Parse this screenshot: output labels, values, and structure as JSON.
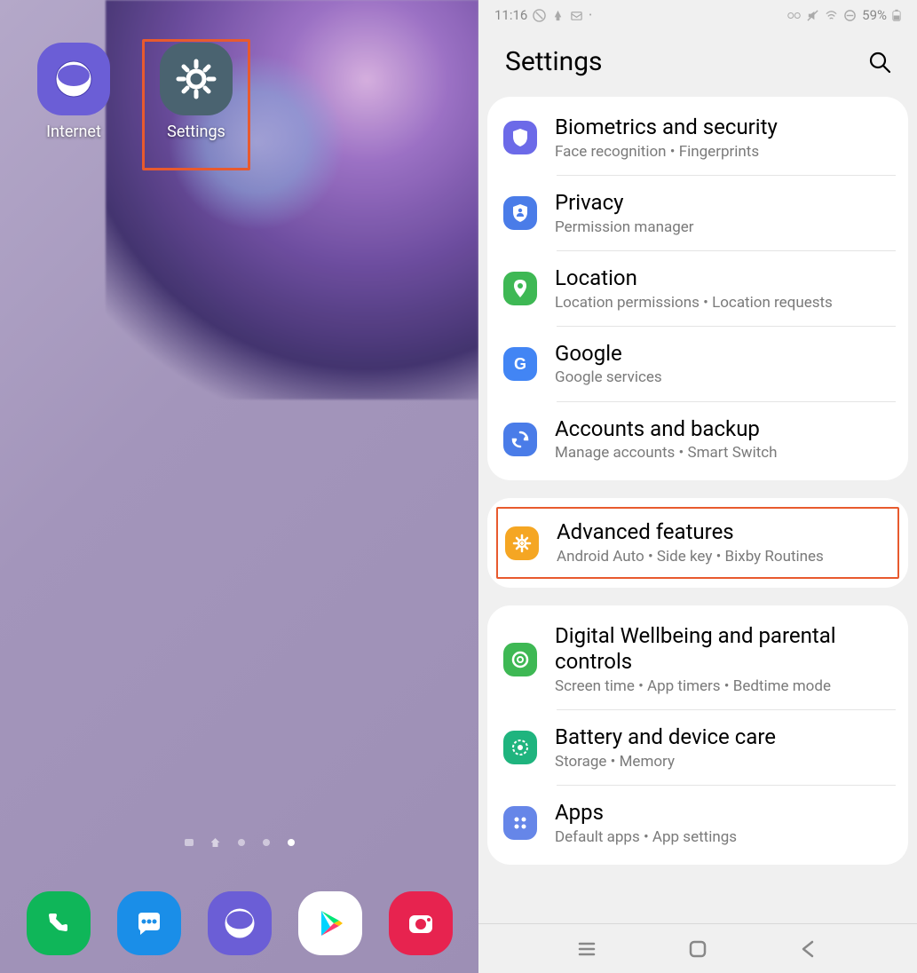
{
  "home": {
    "apps": {
      "internet": {
        "label": "Internet"
      },
      "settings": {
        "label": "Settings"
      }
    },
    "dock_icons": [
      "phone",
      "messages",
      "internet",
      "play-store",
      "camera"
    ]
  },
  "status_bar": {
    "time": "11:16",
    "battery_text": "59%"
  },
  "settings": {
    "title": "Settings",
    "groups": [
      {
        "items": [
          {
            "key": "biometrics",
            "title": "Biometrics and security",
            "sub": "Face recognition  •  Fingerprints",
            "icon_color": "#6c6ae8"
          },
          {
            "key": "privacy",
            "title": "Privacy",
            "sub": "Permission manager",
            "icon_color": "#4a7ce8"
          },
          {
            "key": "location",
            "title": "Location",
            "sub": "Location permissions  •  Location requests",
            "icon_color": "#3eb854"
          },
          {
            "key": "google",
            "title": "Google",
            "sub": "Google services",
            "icon_color": "#4285f4"
          },
          {
            "key": "accounts",
            "title": "Accounts and backup",
            "sub": "Manage accounts  •  Smart Switch",
            "icon_color": "#4a7ce8"
          }
        ]
      },
      {
        "items": [
          {
            "key": "advanced",
            "title": "Advanced features",
            "sub": "Android Auto  •  Side key  •  Bixby Routines",
            "icon_color": "#f5a623",
            "highlighted": true
          }
        ]
      },
      {
        "items": [
          {
            "key": "wellbeing",
            "title": "Digital Wellbeing and parental controls",
            "sub": "Screen time  •  App timers  •  Bedtime mode",
            "icon_color": "#3eb854"
          },
          {
            "key": "battery",
            "title": "Battery and device care",
            "sub": "Storage  •  Memory",
            "icon_color": "#1fb47e"
          },
          {
            "key": "apps",
            "title": "Apps",
            "sub": "Default apps  •  App settings",
            "icon_color": "#6686e8"
          }
        ]
      }
    ]
  }
}
